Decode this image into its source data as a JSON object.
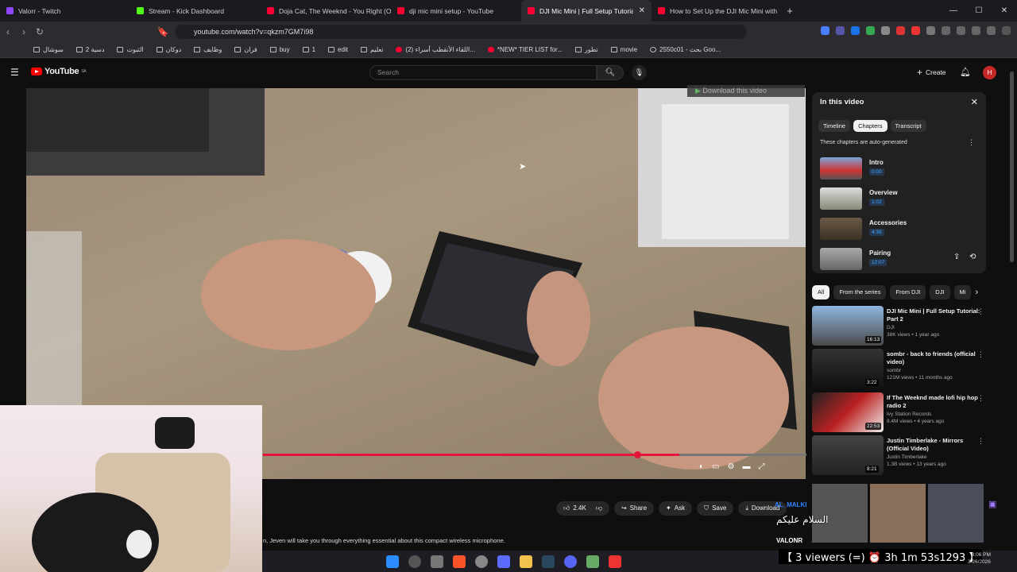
{
  "browser": {
    "tabs": [
      {
        "label": "Valorr - Twitch",
        "color": "#9146ff"
      },
      {
        "label": "Stream - Kick Dashboard",
        "color": "#53fc18"
      },
      {
        "label": "Doja Cat, The Weeknd - You Right (O",
        "color": "#ff0033"
      },
      {
        "label": "dji mic mini setup - YouTube",
        "color": "#ff0033"
      },
      {
        "label": "DJI Mic Mini | Full Setup Tutorial",
        "color": "#ff0033",
        "active": true
      },
      {
        "label": "How to Set Up the DJI Mic Mini with",
        "color": "#ff0033"
      }
    ],
    "url": "youtube.com/watch?v=qkzm7GM7i98",
    "bookmarks": [
      "سوشال",
      "دسية 2",
      "الثبوت",
      "دوكان",
      "وظايف",
      "قران",
      "buy",
      "1",
      "edit",
      "تعليم",
      "(2) اللقاء الأنقطب أسراء...",
      "*NEW* TIER LIST for...",
      "تطور",
      "movie",
      "2550c01 - بحث Goo..."
    ]
  },
  "youtube": {
    "logo": "YouTube",
    "logo_sup": "SA",
    "search_placeholder": "Search",
    "create_label": "Create",
    "avatar_letter": "H",
    "download_overlay": "Download this video",
    "actions": {
      "like_count": "2.4K",
      "share": "Share",
      "ask": "Ask",
      "save": "Save",
      "download": "Download"
    },
    "description": "n, Jeven will take you through everything essential about this compact wireless microphone.",
    "panel": {
      "title": "In this video",
      "tabs": [
        "Timeline",
        "Chapters",
        "Transcript"
      ],
      "auto_note": "These chapters are auto-generated",
      "chapters": [
        {
          "title": "Intro",
          "time": "0:00"
        },
        {
          "title": "Overview",
          "time": "1:02"
        },
        {
          "title": "Accessories",
          "time": "4:39"
        },
        {
          "title": "Pairing",
          "time": "12:07"
        }
      ]
    },
    "chips": [
      "All",
      "From the series",
      "From DJI",
      "DJI",
      "Mi"
    ],
    "related": [
      {
        "title": "DJI Mic Mini | Full Setup Tutorial: Part 2",
        "channel": "DJI",
        "meta": "38K views • 1 year ago",
        "duration": "16:13"
      },
      {
        "title": "sombr - back to friends (official video)",
        "channel": "sombr",
        "meta": "121M views • 11 months ago",
        "duration": "3:22"
      },
      {
        "title": "If The Weeknd made lofi hip hop radio 2",
        "channel": "Ivy Station Records",
        "meta": "8.4M views • 4 years ago",
        "duration": "22:53"
      },
      {
        "title": "Justin Timberlake - Mirrors (Official Video)",
        "channel": "Justin Timberlake",
        "meta": "1.3B views • 13 years ago",
        "duration": "8:21"
      }
    ]
  },
  "stream_overlay": {
    "chat_name": "AL_MALKI",
    "chat_message": "السلام عليكم",
    "name_tag": "VALONR",
    "viewers": "【 3 viewers (=) ⏰ 3h 1m 53s1293 】",
    "clock_time": "3:06 PM",
    "clock_date": "3/26/2026"
  }
}
